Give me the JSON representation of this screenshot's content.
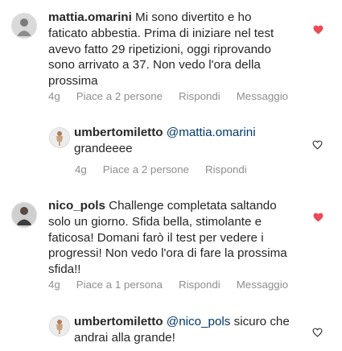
{
  "comments": [
    {
      "username": "mattia.omarini",
      "text": "Mi sono divertito e ho faticato abbestia. Prima di iniziare nel test avevo fatto 29 ripetizioni, oggi riprovando sono arrivato a 37. Non vedo l'ora della prossima",
      "time": "4g",
      "likes": "Piace a 2 persone",
      "reply_label": "Rispondi",
      "message_label": "Messaggio",
      "liked": true
    },
    {
      "username": "umbertomiletto",
      "mention": "@mattia.omarini",
      "text": "grandeeee",
      "time": "4g",
      "likes": "Piace a 2 persone",
      "reply_label": "Rispondi",
      "liked": false
    },
    {
      "username": "nico_pols",
      "text": "Challenge completata saltando solo un giorno. Sfida bella, stimolante e faticosa! Domani farò il test per vedere i progressi! Non vedo l'ora di fare la prossima sfida!!",
      "time": "4g",
      "likes": "Piace a 1 persona",
      "reply_label": "Rispondi",
      "message_label": "Messaggio",
      "liked": true
    },
    {
      "username": "umbertomiletto",
      "mention": "@nico_pols",
      "text": "sicuro che andrai alla grande!",
      "liked": false
    }
  ],
  "colors": {
    "like_red": "#ed4956",
    "meta_gray": "#8e8e8e",
    "mention_blue": "#00376b"
  },
  "icons": {
    "like": "heart-icon"
  }
}
